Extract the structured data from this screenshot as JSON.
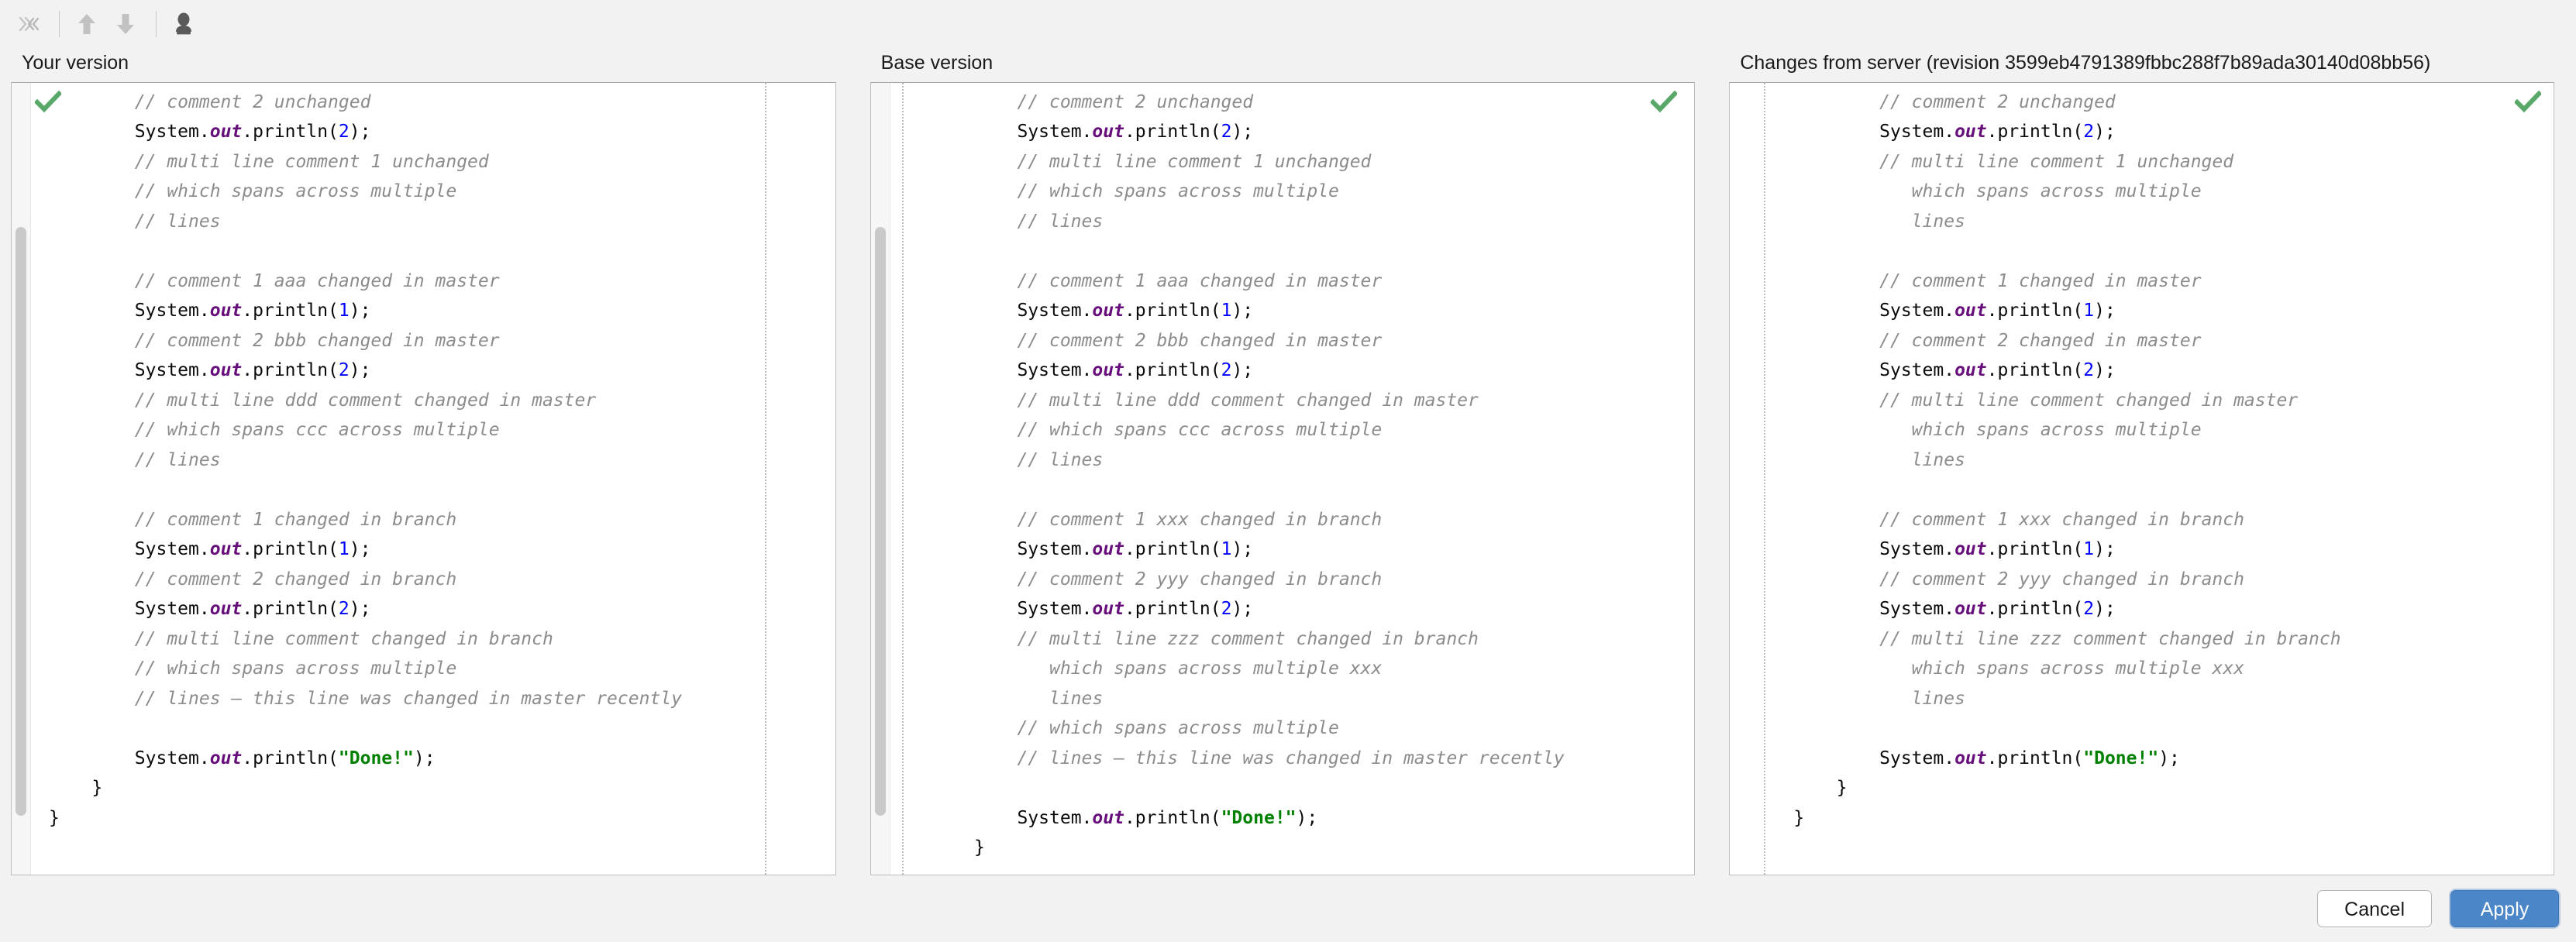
{
  "toolbar": {
    "buttons": [
      {
        "name": "collapse-all-button",
        "icon": "collapse-chevrons-icon",
        "label": "»«",
        "disabled": true
      },
      {
        "name": "previous-difference-button",
        "icon": "arrow-up-icon",
        "label": "↑",
        "disabled": true
      },
      {
        "name": "next-difference-button",
        "icon": "arrow-down-icon",
        "label": "↓",
        "disabled": true
      },
      {
        "name": "magic-resolve-button",
        "icon": "magic-resolve-icon",
        "label": "",
        "disabled": false
      }
    ]
  },
  "panels": [
    {
      "title": "Your version",
      "status_icon": "accepted-checkmark-icon",
      "lines": [
        [
          {
            "t": "        // comment 2 unchanged",
            "c": "cmt"
          }
        ],
        [
          {
            "t": "        ",
            "c": "pln"
          },
          {
            "t": "System",
            "c": "pln"
          },
          {
            "t": ".",
            "c": "pln"
          },
          {
            "t": "out",
            "c": "fld"
          },
          {
            "t": ".println(",
            "c": "pln"
          },
          {
            "t": "2",
            "c": "num"
          },
          {
            "t": ");",
            "c": "pln"
          }
        ],
        [
          {
            "t": "        // multi line comment 1 unchanged",
            "c": "cmt"
          }
        ],
        [
          {
            "t": "        // which spans across multiple",
            "c": "cmt"
          }
        ],
        [
          {
            "t": "        // lines",
            "c": "cmt"
          }
        ],
        [
          {
            "t": "",
            "c": "pln"
          }
        ],
        [
          {
            "t": "        // comment 1 aaa changed in master",
            "c": "cmt"
          }
        ],
        [
          {
            "t": "        ",
            "c": "pln"
          },
          {
            "t": "System",
            "c": "pln"
          },
          {
            "t": ".",
            "c": "pln"
          },
          {
            "t": "out",
            "c": "fld"
          },
          {
            "t": ".println(",
            "c": "pln"
          },
          {
            "t": "1",
            "c": "num"
          },
          {
            "t": ");",
            "c": "pln"
          }
        ],
        [
          {
            "t": "        // comment 2 bbb changed in master",
            "c": "cmt"
          }
        ],
        [
          {
            "t": "        ",
            "c": "pln"
          },
          {
            "t": "System",
            "c": "pln"
          },
          {
            "t": ".",
            "c": "pln"
          },
          {
            "t": "out",
            "c": "fld"
          },
          {
            "t": ".println(",
            "c": "pln"
          },
          {
            "t": "2",
            "c": "num"
          },
          {
            "t": ");",
            "c": "pln"
          }
        ],
        [
          {
            "t": "        // multi line ddd comment changed in master",
            "c": "cmt"
          }
        ],
        [
          {
            "t": "        // which spans ccc across multiple",
            "c": "cmt"
          }
        ],
        [
          {
            "t": "        // lines",
            "c": "cmt"
          }
        ],
        [
          {
            "t": "",
            "c": "pln"
          }
        ],
        [
          {
            "t": "        // comment 1 changed in branch",
            "c": "cmt"
          }
        ],
        [
          {
            "t": "        ",
            "c": "pln"
          },
          {
            "t": "System",
            "c": "pln"
          },
          {
            "t": ".",
            "c": "pln"
          },
          {
            "t": "out",
            "c": "fld"
          },
          {
            "t": ".println(",
            "c": "pln"
          },
          {
            "t": "1",
            "c": "num"
          },
          {
            "t": ");",
            "c": "pln"
          }
        ],
        [
          {
            "t": "        // comment 2 changed in branch",
            "c": "cmt"
          }
        ],
        [
          {
            "t": "        ",
            "c": "pln"
          },
          {
            "t": "System",
            "c": "pln"
          },
          {
            "t": ".",
            "c": "pln"
          },
          {
            "t": "out",
            "c": "fld"
          },
          {
            "t": ".println(",
            "c": "pln"
          },
          {
            "t": "2",
            "c": "num"
          },
          {
            "t": ");",
            "c": "pln"
          }
        ],
        [
          {
            "t": "        // multi line comment changed in branch",
            "c": "cmt"
          }
        ],
        [
          {
            "t": "        // which spans across multiple",
            "c": "cmt"
          }
        ],
        [
          {
            "t": "        // lines – this line was changed in master recently",
            "c": "cmt"
          }
        ],
        [
          {
            "t": "",
            "c": "pln"
          }
        ],
        [
          {
            "t": "        ",
            "c": "pln"
          },
          {
            "t": "System",
            "c": "pln"
          },
          {
            "t": ".",
            "c": "pln"
          },
          {
            "t": "out",
            "c": "fld"
          },
          {
            "t": ".println(",
            "c": "pln"
          },
          {
            "t": "\"Done!\"",
            "c": "str"
          },
          {
            "t": ");",
            "c": "pln"
          }
        ],
        [
          {
            "t": "    }",
            "c": "pln"
          }
        ],
        [
          {
            "t": "}",
            "c": "pln"
          }
        ]
      ]
    },
    {
      "title": "Base version",
      "status_icon": "accepted-checkmark-icon",
      "lines": [
        [
          {
            "t": "        // comment 2 unchanged",
            "c": "cmt"
          }
        ],
        [
          {
            "t": "        ",
            "c": "pln"
          },
          {
            "t": "System",
            "c": "pln"
          },
          {
            "t": ".",
            "c": "pln"
          },
          {
            "t": "out",
            "c": "fld"
          },
          {
            "t": ".println(",
            "c": "pln"
          },
          {
            "t": "2",
            "c": "num"
          },
          {
            "t": ");",
            "c": "pln"
          }
        ],
        [
          {
            "t": "        // multi line comment 1 unchanged",
            "c": "cmt"
          }
        ],
        [
          {
            "t": "        // which spans across multiple",
            "c": "cmt"
          }
        ],
        [
          {
            "t": "        // lines",
            "c": "cmt"
          }
        ],
        [
          {
            "t": "",
            "c": "pln"
          }
        ],
        [
          {
            "t": "        // comment 1 aaa changed in master",
            "c": "cmt"
          }
        ],
        [
          {
            "t": "        ",
            "c": "pln"
          },
          {
            "t": "System",
            "c": "pln"
          },
          {
            "t": ".",
            "c": "pln"
          },
          {
            "t": "out",
            "c": "fld"
          },
          {
            "t": ".println(",
            "c": "pln"
          },
          {
            "t": "1",
            "c": "num"
          },
          {
            "t": ");",
            "c": "pln"
          }
        ],
        [
          {
            "t": "        // comment 2 bbb changed in master",
            "c": "cmt"
          }
        ],
        [
          {
            "t": "        ",
            "c": "pln"
          },
          {
            "t": "System",
            "c": "pln"
          },
          {
            "t": ".",
            "c": "pln"
          },
          {
            "t": "out",
            "c": "fld"
          },
          {
            "t": ".println(",
            "c": "pln"
          },
          {
            "t": "2",
            "c": "num"
          },
          {
            "t": ");",
            "c": "pln"
          }
        ],
        [
          {
            "t": "        // multi line ddd comment changed in master",
            "c": "cmt"
          }
        ],
        [
          {
            "t": "        // which spans ccc across multiple",
            "c": "cmt"
          }
        ],
        [
          {
            "t": "        // lines",
            "c": "cmt"
          }
        ],
        [
          {
            "t": "",
            "c": "pln"
          }
        ],
        [
          {
            "t": "        // comment 1 xxx changed in branch",
            "c": "cmt"
          }
        ],
        [
          {
            "t": "        ",
            "c": "pln"
          },
          {
            "t": "System",
            "c": "pln"
          },
          {
            "t": ".",
            "c": "pln"
          },
          {
            "t": "out",
            "c": "fld"
          },
          {
            "t": ".println(",
            "c": "pln"
          },
          {
            "t": "1",
            "c": "num"
          },
          {
            "t": ");",
            "c": "pln"
          }
        ],
        [
          {
            "t": "        // comment 2 yyy changed in branch",
            "c": "cmt"
          }
        ],
        [
          {
            "t": "        ",
            "c": "pln"
          },
          {
            "t": "System",
            "c": "pln"
          },
          {
            "t": ".",
            "c": "pln"
          },
          {
            "t": "out",
            "c": "fld"
          },
          {
            "t": ".println(",
            "c": "pln"
          },
          {
            "t": "2",
            "c": "num"
          },
          {
            "t": ");",
            "c": "pln"
          }
        ],
        [
          {
            "t": "        // multi line zzz comment changed in branch",
            "c": "cmt"
          }
        ],
        [
          {
            "t": "           which spans across multiple xxx",
            "c": "cmt"
          }
        ],
        [
          {
            "t": "           lines",
            "c": "cmt"
          }
        ],
        [
          {
            "t": "        // which spans across multiple",
            "c": "cmt"
          }
        ],
        [
          {
            "t": "        // lines – this line was changed in master recently",
            "c": "cmt"
          }
        ],
        [
          {
            "t": "",
            "c": "pln"
          }
        ],
        [
          {
            "t": "        ",
            "c": "pln"
          },
          {
            "t": "System",
            "c": "pln"
          },
          {
            "t": ".",
            "c": "pln"
          },
          {
            "t": "out",
            "c": "fld"
          },
          {
            "t": ".println(",
            "c": "pln"
          },
          {
            "t": "\"Done!\"",
            "c": "str"
          },
          {
            "t": ");",
            "c": "pln"
          }
        ],
        [
          {
            "t": "    }",
            "c": "pln"
          }
        ]
      ]
    },
    {
      "title": "Changes from server (revision 3599eb4791389fbbc288f7b89ada30140d08bb56)",
      "status_icon": "accepted-checkmark-icon",
      "lines": [
        [
          {
            "t": "        // comment 2 unchanged",
            "c": "cmt"
          }
        ],
        [
          {
            "t": "        ",
            "c": "pln"
          },
          {
            "t": "System",
            "c": "pln"
          },
          {
            "t": ".",
            "c": "pln"
          },
          {
            "t": "out",
            "c": "fld"
          },
          {
            "t": ".println(",
            "c": "pln"
          },
          {
            "t": "2",
            "c": "num"
          },
          {
            "t": ");",
            "c": "pln"
          }
        ],
        [
          {
            "t": "        // multi line comment 1 unchanged",
            "c": "cmt"
          }
        ],
        [
          {
            "t": "           which spans across multiple",
            "c": "cmt"
          }
        ],
        [
          {
            "t": "           lines",
            "c": "cmt"
          }
        ],
        [
          {
            "t": "",
            "c": "pln"
          }
        ],
        [
          {
            "t": "        // comment 1 changed in master",
            "c": "cmt"
          }
        ],
        [
          {
            "t": "        ",
            "c": "pln"
          },
          {
            "t": "System",
            "c": "pln"
          },
          {
            "t": ".",
            "c": "pln"
          },
          {
            "t": "out",
            "c": "fld"
          },
          {
            "t": ".println(",
            "c": "pln"
          },
          {
            "t": "1",
            "c": "num"
          },
          {
            "t": ");",
            "c": "pln"
          }
        ],
        [
          {
            "t": "        // comment 2 changed in master",
            "c": "cmt"
          }
        ],
        [
          {
            "t": "        ",
            "c": "pln"
          },
          {
            "t": "System",
            "c": "pln"
          },
          {
            "t": ".",
            "c": "pln"
          },
          {
            "t": "out",
            "c": "fld"
          },
          {
            "t": ".println(",
            "c": "pln"
          },
          {
            "t": "2",
            "c": "num"
          },
          {
            "t": ");",
            "c": "pln"
          }
        ],
        [
          {
            "t": "        // multi line comment changed in master",
            "c": "cmt"
          }
        ],
        [
          {
            "t": "           which spans across multiple",
            "c": "cmt"
          }
        ],
        [
          {
            "t": "           lines",
            "c": "cmt"
          }
        ],
        [
          {
            "t": "",
            "c": "pln"
          }
        ],
        [
          {
            "t": "        // comment 1 xxx changed in branch",
            "c": "cmt"
          }
        ],
        [
          {
            "t": "        ",
            "c": "pln"
          },
          {
            "t": "System",
            "c": "pln"
          },
          {
            "t": ".",
            "c": "pln"
          },
          {
            "t": "out",
            "c": "fld"
          },
          {
            "t": ".println(",
            "c": "pln"
          },
          {
            "t": "1",
            "c": "num"
          },
          {
            "t": ");",
            "c": "pln"
          }
        ],
        [
          {
            "t": "        // comment 2 yyy changed in branch",
            "c": "cmt"
          }
        ],
        [
          {
            "t": "        ",
            "c": "pln"
          },
          {
            "t": "System",
            "c": "pln"
          },
          {
            "t": ".",
            "c": "pln"
          },
          {
            "t": "out",
            "c": "fld"
          },
          {
            "t": ".println(",
            "c": "pln"
          },
          {
            "t": "2",
            "c": "num"
          },
          {
            "t": ");",
            "c": "pln"
          }
        ],
        [
          {
            "t": "        // multi line zzz comment changed in branch",
            "c": "cmt"
          }
        ],
        [
          {
            "t": "           which spans across multiple xxx",
            "c": "cmt"
          }
        ],
        [
          {
            "t": "           lines",
            "c": "cmt"
          }
        ],
        [
          {
            "t": "",
            "c": "pln"
          }
        ],
        [
          {
            "t": "        ",
            "c": "pln"
          },
          {
            "t": "System",
            "c": "pln"
          },
          {
            "t": ".",
            "c": "pln"
          },
          {
            "t": "out",
            "c": "fld"
          },
          {
            "t": ".println(",
            "c": "pln"
          },
          {
            "t": "\"Done!\"",
            "c": "str"
          },
          {
            "t": ");",
            "c": "pln"
          }
        ],
        [
          {
            "t": "    }",
            "c": "pln"
          }
        ],
        [
          {
            "t": "}",
            "c": "pln"
          }
        ]
      ]
    }
  ],
  "footer": {
    "cancel_label": "Cancel",
    "apply_label": "Apply"
  },
  "colors": {
    "accent": "#4a86c8",
    "comment": "#8c8c8c",
    "field": "#660e7a",
    "number": "#0000ff",
    "string": "#008000",
    "check": "#59a869"
  }
}
